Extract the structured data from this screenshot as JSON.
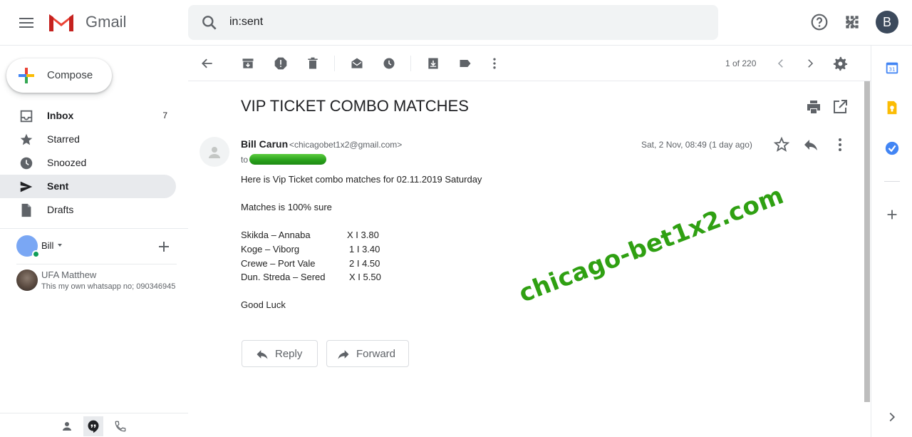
{
  "header": {
    "app_name": "Gmail",
    "search_value": "in:sent",
    "avatar_letter": "B"
  },
  "compose": {
    "label": "Compose"
  },
  "nav": {
    "items": [
      {
        "label": "Inbox",
        "count": "7",
        "icon": "inbox-icon"
      },
      {
        "label": "Starred",
        "count": "",
        "icon": "star-icon"
      },
      {
        "label": "Snoozed",
        "count": "",
        "icon": "clock-icon"
      },
      {
        "label": "Sent",
        "count": "",
        "icon": "send-icon"
      },
      {
        "label": "Drafts",
        "count": "",
        "icon": "draft-icon"
      }
    ]
  },
  "hangouts": {
    "me": {
      "name": "Bill"
    },
    "contacts": [
      {
        "name": "UFA Matthew",
        "message": "This my own whatsapp no; 090346945"
      }
    ]
  },
  "toolbar": {
    "counter": "1 of 220"
  },
  "message": {
    "subject": "VIP TICKET COMBO MATCHES",
    "sender_name": "Bill Carun",
    "sender_email": "<chicagobet1x2@gmail.com>",
    "to_prefix": "to",
    "date": "Sat, 2 Nov, 08:49 (1 day ago)",
    "intro": "Here is Vip Ticket combo matches for 02.11.2019 Saturday",
    "sure_line": "Matches is 100% sure",
    "matches": [
      {
        "teams": "Skikda – Annaba",
        "odds": "X I 3.80"
      },
      {
        "teams": "Koge – Viborg",
        "odds": "1 I 3.40"
      },
      {
        "teams": "Crewe – Port Vale",
        "odds": "2 I 4.50"
      },
      {
        "teams": "Dun. Streda – Sered",
        "odds": "X I 5.50"
      }
    ],
    "closing": "Good Luck",
    "watermark": "chicago-bet1x2.com",
    "reply_label": "Reply",
    "forward_label": "Forward"
  },
  "colors": {
    "accent_green": "#2fa012",
    "active_nav_bg": "#e8eaed",
    "text_primary": "#202124",
    "text_secondary": "#5f6368"
  }
}
